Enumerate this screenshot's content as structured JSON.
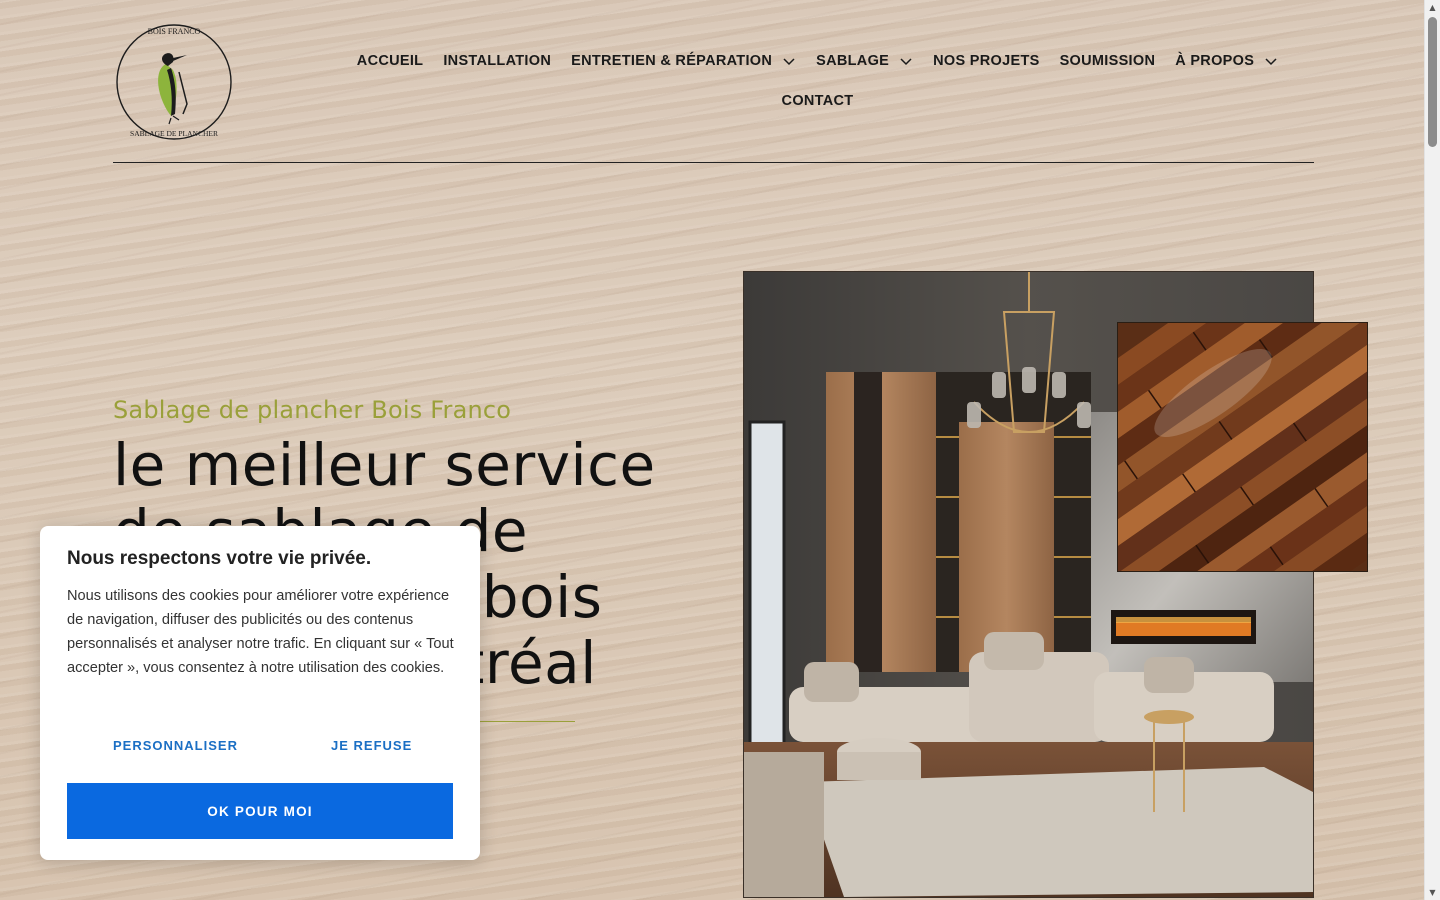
{
  "header": {
    "logo": {
      "text_top": "BOIS FRANCO",
      "text_bottom": "SABLAGE DE PLANCHER",
      "bird_color": "#8db43c"
    },
    "nav": {
      "row1": [
        {
          "label": "ACCUEIL",
          "dropdown": false
        },
        {
          "label": "INSTALLATION",
          "dropdown": false
        },
        {
          "label": "ENTRETIEN & RÉPARATION",
          "dropdown": true
        },
        {
          "label": "SABLAGE",
          "dropdown": true
        },
        {
          "label": "NOS PROJETS",
          "dropdown": false
        },
        {
          "label": "SOUMISSION",
          "dropdown": false
        },
        {
          "label": "À PROPOS",
          "dropdown": true
        }
      ],
      "row2": [
        {
          "label": "CONTACT",
          "dropdown": false
        }
      ]
    }
  },
  "hero": {
    "eyebrow": "Sablage de plancher Bois Franco",
    "headline": "le meilleur service de sablage de plancher de bois franc à Montréal",
    "accent_color": "#9aa03a"
  },
  "images": {
    "room": "living-room-photo",
    "floor": "hardwood-floor-photo"
  },
  "cookie_banner": {
    "title": "Nous respectons votre vie privée.",
    "text": "Nous utilisons des cookies pour améliorer votre expérience de navigation, diffuser des publicités ou des contenus personnalisés et analyser notre trafic. En cliquant sur « Tout accepter », vous consentez à notre utilisation des cookies.",
    "customize_label": "PERSONNALISER",
    "refuse_label": "JE REFUSE",
    "accept_label": "OK POUR MOI",
    "accent_color": "#0a69e0"
  }
}
